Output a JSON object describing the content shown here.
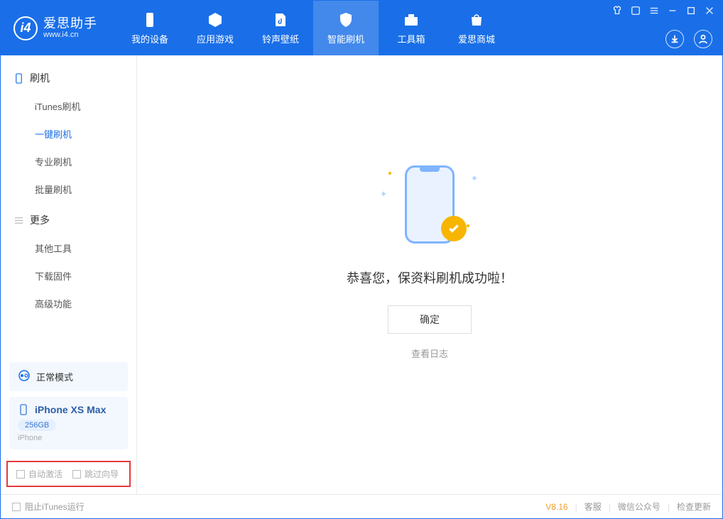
{
  "header": {
    "app_name": "爱思助手",
    "app_url": "www.i4.cn",
    "tabs": [
      {
        "label": "我的设备"
      },
      {
        "label": "应用游戏"
      },
      {
        "label": "铃声壁纸"
      },
      {
        "label": "智能刷机"
      },
      {
        "label": "工具箱"
      },
      {
        "label": "爱思商城"
      }
    ]
  },
  "sidebar": {
    "section1_title": "刷机",
    "items1": [
      {
        "label": "iTunes刷机"
      },
      {
        "label": "一键刷机"
      },
      {
        "label": "专业刷机"
      },
      {
        "label": "批量刷机"
      }
    ],
    "section2_title": "更多",
    "items2": [
      {
        "label": "其他工具"
      },
      {
        "label": "下载固件"
      },
      {
        "label": "高级功能"
      }
    ],
    "mode_label": "正常模式",
    "device": {
      "name": "iPhone XS Max",
      "storage": "256GB",
      "type": "iPhone"
    },
    "checks": {
      "auto_activate": "自动激活",
      "skip_guide": "跳过向导"
    }
  },
  "main": {
    "success_msg": "恭喜您，保资料刷机成功啦！",
    "ok_label": "确定",
    "log_link": "查看日志"
  },
  "footer": {
    "block_itunes": "阻止iTunes运行",
    "version": "V8.16",
    "links": [
      "客服",
      "微信公众号",
      "检查更新"
    ]
  }
}
